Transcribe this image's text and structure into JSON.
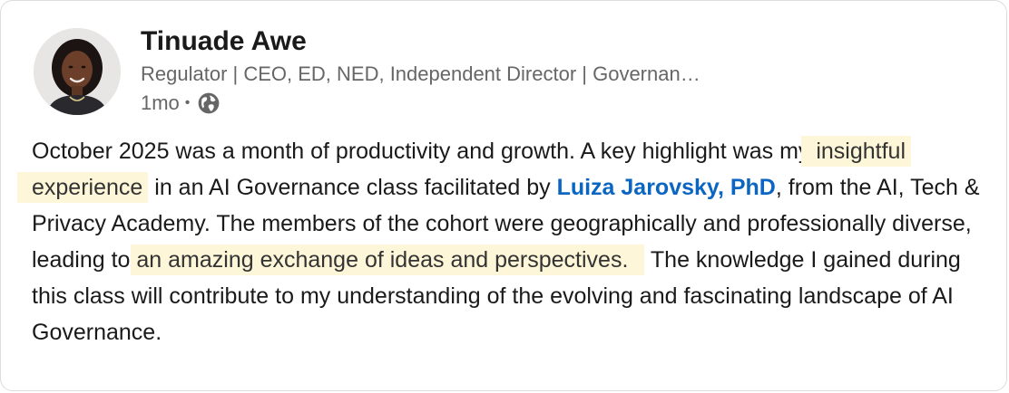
{
  "post": {
    "author": {
      "name": "Tinuade Awe",
      "headline": "Regulator | CEO, ED, NED, Independent Director | Governan…",
      "time": "1mo",
      "separator": "•",
      "visibility_icon": "globe-icon"
    },
    "body": {
      "seg1": "October 2025 was a month of productivity and growth. A key highlight was my ",
      "highlight1": "insightful experience",
      "seg2": " in an AI Governance class facilitated by ",
      "mention": "Luiza Jarovsky, PhD",
      "seg3": ", from the AI, Tech & Privacy Academy. The members of the cohort were geographically and professionally diverse, leading to ",
      "highlight2": "an amazing exchange of ideas and perspectives.",
      "seg4": " The knowledge I gained during this class will contribute to my understanding of the evolving and fascinating landscape of AI Governance."
    },
    "colors": {
      "mention": "#0a66c2",
      "highlight_bg": "#fdf6d8",
      "text": "#1a1a1a",
      "secondary_text": "#666666"
    }
  }
}
